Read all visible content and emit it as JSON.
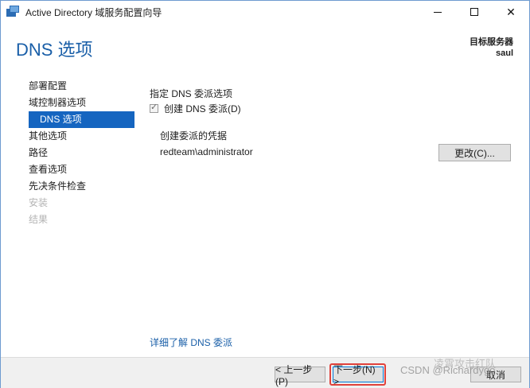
{
  "window": {
    "title": "Active Directory 域服务配置向导"
  },
  "header": {
    "page_title": "DNS 选项",
    "target_label": "目标服务器",
    "target_server": "saul"
  },
  "sidebar": {
    "items": [
      {
        "label": "部署配置",
        "state": "normal"
      },
      {
        "label": "域控制器选项",
        "state": "normal"
      },
      {
        "label": "DNS 选项",
        "state": "active"
      },
      {
        "label": "其他选项",
        "state": "normal"
      },
      {
        "label": "路径",
        "state": "normal"
      },
      {
        "label": "查看选项",
        "state": "normal"
      },
      {
        "label": "先决条件检查",
        "state": "normal"
      },
      {
        "label": "安装",
        "state": "disabled"
      },
      {
        "label": "结果",
        "state": "disabled"
      }
    ]
  },
  "main": {
    "section_label": "指定 DNS 委派选项",
    "checkbox_label": "创建 DNS 委派(D)",
    "checkbox_checked": true,
    "credentials_label": "创建委派的凭据",
    "credentials_value": "redteam\\administrator",
    "change_button": "更改(C)...",
    "learn_more": "详细了解 DNS 委派"
  },
  "footer": {
    "prev": "< 上一步(P)",
    "next": "下一步(N) >",
    "cancel": "取消"
  },
  "watermark": {
    "text": "CSDN @Richardygo",
    "brand": "凌霄攻击红队"
  },
  "colors": {
    "accent": "#1565c0",
    "title_blue": "#1a5fa8",
    "highlight": "#e0413b"
  }
}
